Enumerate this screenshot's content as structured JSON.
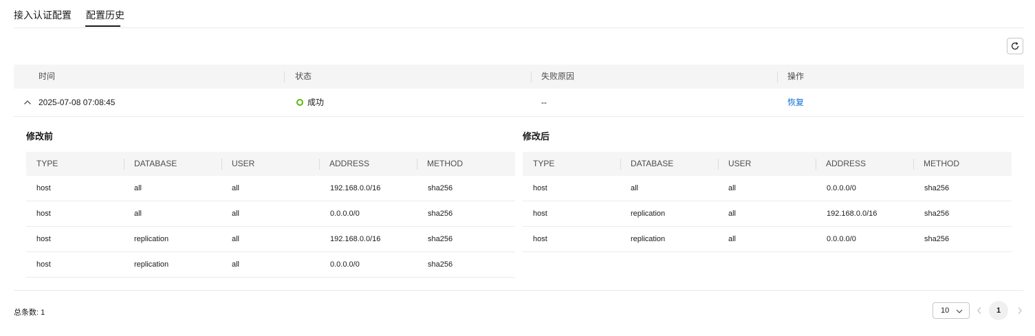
{
  "tabs": [
    {
      "label": "接入认证配置",
      "active": false
    },
    {
      "label": "配置历史",
      "active": true
    }
  ],
  "toolbar": {
    "refresh_icon": "refresh-icon"
  },
  "history_table": {
    "headers": [
      "时间",
      "状态",
      "失败原因",
      "操作"
    ],
    "rows": [
      {
        "time": "2025-07-08 07:08:45",
        "status": "成功",
        "status_color": "#5ab70a",
        "reason": "--",
        "action": "恢复",
        "expanded": true
      }
    ]
  },
  "before": {
    "title": "修改前",
    "headers": [
      "TYPE",
      "DATABASE",
      "USER",
      "ADDRESS",
      "METHOD"
    ],
    "rows": [
      [
        "host",
        "all",
        "all",
        "192.168.0.0/16",
        "sha256"
      ],
      [
        "host",
        "all",
        "all",
        "0.0.0.0/0",
        "sha256"
      ],
      [
        "host",
        "replication",
        "all",
        "192.168.0.0/16",
        "sha256"
      ],
      [
        "host",
        "replication",
        "all",
        "0.0.0.0/0",
        "sha256"
      ]
    ]
  },
  "after": {
    "title": "修改后",
    "headers": [
      "TYPE",
      "DATABASE",
      "USER",
      "ADDRESS",
      "METHOD"
    ],
    "rows": [
      [
        "host",
        "all",
        "all",
        "0.0.0.0/0",
        "sha256"
      ],
      [
        "host",
        "replication",
        "all",
        "192.168.0.0/16",
        "sha256"
      ],
      [
        "host",
        "replication",
        "all",
        "0.0.0.0/0",
        "sha256"
      ]
    ]
  },
  "pagination": {
    "total_label": "总条数:",
    "total": "1",
    "page_size": "10",
    "current_page": "1"
  },
  "colors": {
    "link": "#0b6fd6",
    "success": "#5ab70a",
    "header_bg": "#f5f5f5"
  }
}
